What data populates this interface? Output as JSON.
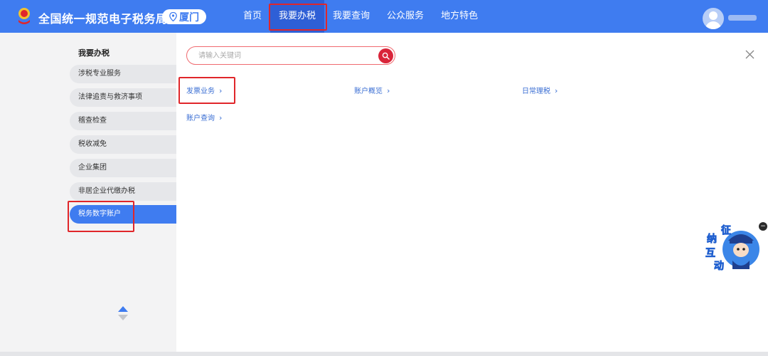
{
  "header": {
    "site_title": "全国统一规范电子税务局",
    "city": "厦门",
    "nav": [
      {
        "label": "首页"
      },
      {
        "label": "我要办税"
      },
      {
        "label": "我要查询"
      },
      {
        "label": "公众服务"
      },
      {
        "label": "地方特色"
      }
    ],
    "active_nav": "我要办税"
  },
  "sidebar": {
    "title": "我要办税",
    "items": [
      {
        "label": "涉税专业服务"
      },
      {
        "label": "法律追责与救济事项"
      },
      {
        "label": "稽查检查"
      },
      {
        "label": "税收减免"
      },
      {
        "label": "企业集团"
      },
      {
        "label": "非居企业代缴办税"
      },
      {
        "label": "税务数字账户"
      }
    ],
    "active_item": "税务数字账户"
  },
  "content": {
    "search": {
      "placeholder": "请输入关键词"
    },
    "links": [
      {
        "label": "发票业务"
      },
      {
        "label": "账户概览"
      },
      {
        "label": "日常理税"
      },
      {
        "label": "账户查询"
      }
    ]
  },
  "float_widget": {
    "label": [
      "征",
      "纳",
      "互",
      "动"
    ]
  },
  "colors": {
    "header_blue": "#3f7cf0",
    "active_nav_blue": "#2e5fd6",
    "highlight_red": "#e0262a",
    "link_blue": "#3a6ed3",
    "search_red": "#d9253a"
  }
}
